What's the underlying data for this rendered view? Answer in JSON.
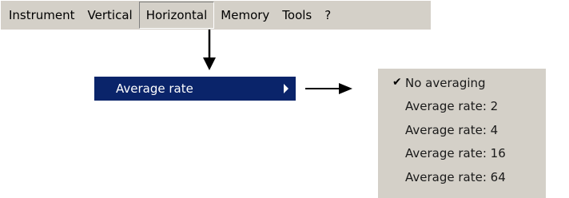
{
  "menubar": {
    "items": [
      {
        "label": "Instrument"
      },
      {
        "label": "Vertical"
      },
      {
        "label": "Horizontal"
      },
      {
        "label": "Memory"
      },
      {
        "label": "Tools"
      },
      {
        "label": "?"
      }
    ]
  },
  "submenu": {
    "highlighted_label": "Average rate",
    "highlight_color": "#0a246a"
  },
  "options": {
    "items": [
      {
        "label": "No averaging",
        "checked": true
      },
      {
        "label": "Average rate: 2",
        "checked": false
      },
      {
        "label": "Average rate: 4",
        "checked": false
      },
      {
        "label": "Average rate: 16",
        "checked": false
      },
      {
        "label": "Average rate: 64",
        "checked": false
      }
    ],
    "check_glyph": "✔"
  },
  "colors": {
    "menu_background": "#d4d0c8",
    "selection": "#0a246a"
  }
}
